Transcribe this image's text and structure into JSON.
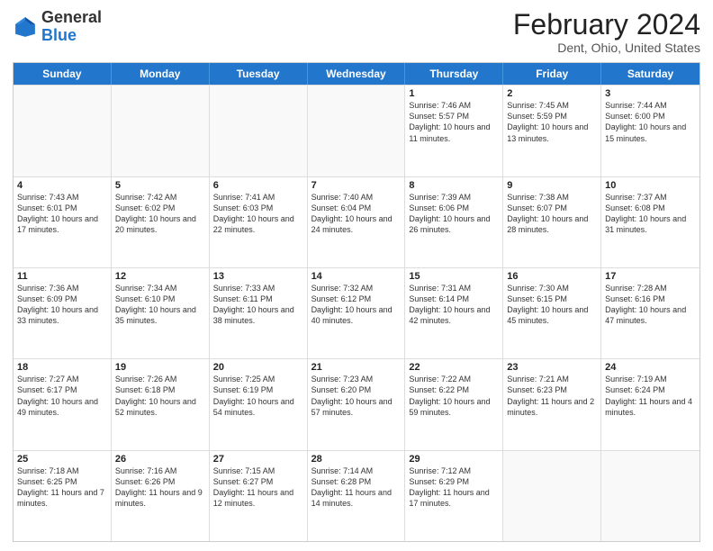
{
  "header": {
    "logo_general": "General",
    "logo_blue": "Blue",
    "title": "February 2024",
    "subtitle": "Dent, Ohio, United States"
  },
  "calendar": {
    "days_of_week": [
      "Sunday",
      "Monday",
      "Tuesday",
      "Wednesday",
      "Thursday",
      "Friday",
      "Saturday"
    ],
    "rows": [
      [
        {
          "day": "",
          "info": "",
          "empty": true
        },
        {
          "day": "",
          "info": "",
          "empty": true
        },
        {
          "day": "",
          "info": "",
          "empty": true
        },
        {
          "day": "",
          "info": "",
          "empty": true
        },
        {
          "day": "1",
          "info": "Sunrise: 7:46 AM\nSunset: 5:57 PM\nDaylight: 10 hours and 11 minutes.",
          "empty": false
        },
        {
          "day": "2",
          "info": "Sunrise: 7:45 AM\nSunset: 5:59 PM\nDaylight: 10 hours and 13 minutes.",
          "empty": false
        },
        {
          "day": "3",
          "info": "Sunrise: 7:44 AM\nSunset: 6:00 PM\nDaylight: 10 hours and 15 minutes.",
          "empty": false
        }
      ],
      [
        {
          "day": "4",
          "info": "Sunrise: 7:43 AM\nSunset: 6:01 PM\nDaylight: 10 hours and 17 minutes.",
          "empty": false
        },
        {
          "day": "5",
          "info": "Sunrise: 7:42 AM\nSunset: 6:02 PM\nDaylight: 10 hours and 20 minutes.",
          "empty": false
        },
        {
          "day": "6",
          "info": "Sunrise: 7:41 AM\nSunset: 6:03 PM\nDaylight: 10 hours and 22 minutes.",
          "empty": false
        },
        {
          "day": "7",
          "info": "Sunrise: 7:40 AM\nSunset: 6:04 PM\nDaylight: 10 hours and 24 minutes.",
          "empty": false
        },
        {
          "day": "8",
          "info": "Sunrise: 7:39 AM\nSunset: 6:06 PM\nDaylight: 10 hours and 26 minutes.",
          "empty": false
        },
        {
          "day": "9",
          "info": "Sunrise: 7:38 AM\nSunset: 6:07 PM\nDaylight: 10 hours and 28 minutes.",
          "empty": false
        },
        {
          "day": "10",
          "info": "Sunrise: 7:37 AM\nSunset: 6:08 PM\nDaylight: 10 hours and 31 minutes.",
          "empty": false
        }
      ],
      [
        {
          "day": "11",
          "info": "Sunrise: 7:36 AM\nSunset: 6:09 PM\nDaylight: 10 hours and 33 minutes.",
          "empty": false
        },
        {
          "day": "12",
          "info": "Sunrise: 7:34 AM\nSunset: 6:10 PM\nDaylight: 10 hours and 35 minutes.",
          "empty": false
        },
        {
          "day": "13",
          "info": "Sunrise: 7:33 AM\nSunset: 6:11 PM\nDaylight: 10 hours and 38 minutes.",
          "empty": false
        },
        {
          "day": "14",
          "info": "Sunrise: 7:32 AM\nSunset: 6:12 PM\nDaylight: 10 hours and 40 minutes.",
          "empty": false
        },
        {
          "day": "15",
          "info": "Sunrise: 7:31 AM\nSunset: 6:14 PM\nDaylight: 10 hours and 42 minutes.",
          "empty": false
        },
        {
          "day": "16",
          "info": "Sunrise: 7:30 AM\nSunset: 6:15 PM\nDaylight: 10 hours and 45 minutes.",
          "empty": false
        },
        {
          "day": "17",
          "info": "Sunrise: 7:28 AM\nSunset: 6:16 PM\nDaylight: 10 hours and 47 minutes.",
          "empty": false
        }
      ],
      [
        {
          "day": "18",
          "info": "Sunrise: 7:27 AM\nSunset: 6:17 PM\nDaylight: 10 hours and 49 minutes.",
          "empty": false
        },
        {
          "day": "19",
          "info": "Sunrise: 7:26 AM\nSunset: 6:18 PM\nDaylight: 10 hours and 52 minutes.",
          "empty": false
        },
        {
          "day": "20",
          "info": "Sunrise: 7:25 AM\nSunset: 6:19 PM\nDaylight: 10 hours and 54 minutes.",
          "empty": false
        },
        {
          "day": "21",
          "info": "Sunrise: 7:23 AM\nSunset: 6:20 PM\nDaylight: 10 hours and 57 minutes.",
          "empty": false
        },
        {
          "day": "22",
          "info": "Sunrise: 7:22 AM\nSunset: 6:22 PM\nDaylight: 10 hours and 59 minutes.",
          "empty": false
        },
        {
          "day": "23",
          "info": "Sunrise: 7:21 AM\nSunset: 6:23 PM\nDaylight: 11 hours and 2 minutes.",
          "empty": false
        },
        {
          "day": "24",
          "info": "Sunrise: 7:19 AM\nSunset: 6:24 PM\nDaylight: 11 hours and 4 minutes.",
          "empty": false
        }
      ],
      [
        {
          "day": "25",
          "info": "Sunrise: 7:18 AM\nSunset: 6:25 PM\nDaylight: 11 hours and 7 minutes.",
          "empty": false
        },
        {
          "day": "26",
          "info": "Sunrise: 7:16 AM\nSunset: 6:26 PM\nDaylight: 11 hours and 9 minutes.",
          "empty": false
        },
        {
          "day": "27",
          "info": "Sunrise: 7:15 AM\nSunset: 6:27 PM\nDaylight: 11 hours and 12 minutes.",
          "empty": false
        },
        {
          "day": "28",
          "info": "Sunrise: 7:14 AM\nSunset: 6:28 PM\nDaylight: 11 hours and 14 minutes.",
          "empty": false
        },
        {
          "day": "29",
          "info": "Sunrise: 7:12 AM\nSunset: 6:29 PM\nDaylight: 11 hours and 17 minutes.",
          "empty": false
        },
        {
          "day": "",
          "info": "",
          "empty": true
        },
        {
          "day": "",
          "info": "",
          "empty": true
        }
      ]
    ]
  }
}
